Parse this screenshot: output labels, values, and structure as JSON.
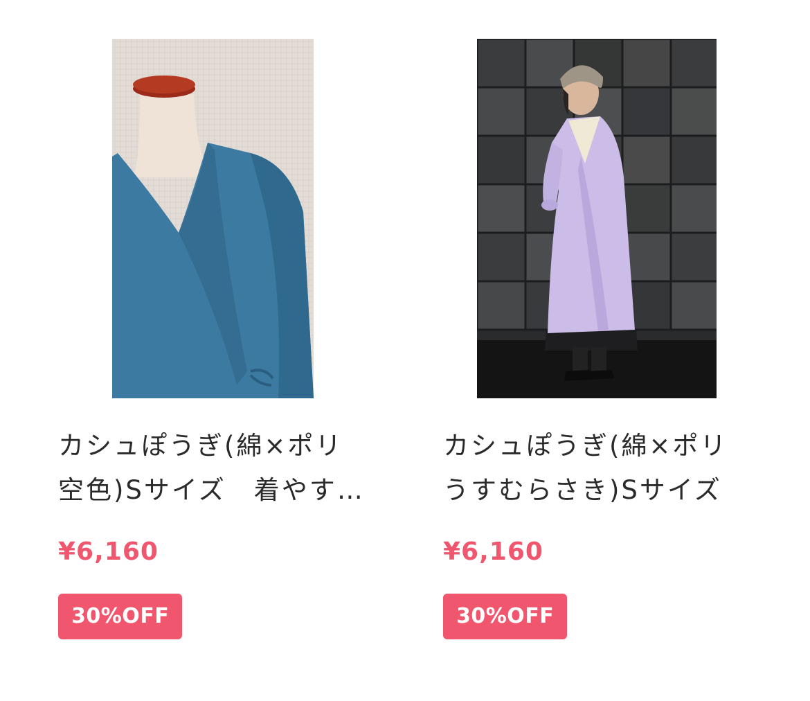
{
  "products": [
    {
      "title": "カシュぽうぎ(綿×ポリ空色)Sサイズ　着やすい",
      "price": "¥6,160",
      "discount_badge": "30%OFF",
      "image_alt": "blue kashu smock on mannequin"
    },
    {
      "title": "カシュぽうぎ(綿×ポリうすむらさき)Sサイズ",
      "price": "¥6,160",
      "discount_badge": "30%OFF",
      "image_alt": "lavender kashu smock worn by model"
    }
  ],
  "colors": {
    "price": "#f0566e",
    "badge_bg": "#f0566e",
    "badge_text": "#ffffff",
    "title_text": "#2a2a2a"
  }
}
